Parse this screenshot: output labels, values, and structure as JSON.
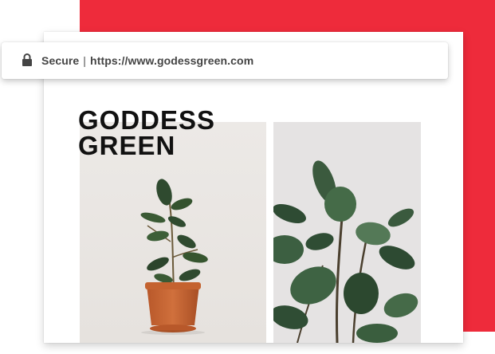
{
  "colors": {
    "accent": "#ee2b3b",
    "title": "#111111",
    "url_text": "#444444"
  },
  "address_bar": {
    "lock_icon": "lock-icon",
    "security_label": "Secure",
    "separator": "|",
    "url": "https://www.godessgreen.com"
  },
  "site": {
    "title_line1": "GODDESS",
    "title_line2": "GREEN"
  },
  "images": [
    {
      "name": "potted-rubber-plant-photo"
    },
    {
      "name": "rubber-plant-leaves-photo"
    }
  ]
}
